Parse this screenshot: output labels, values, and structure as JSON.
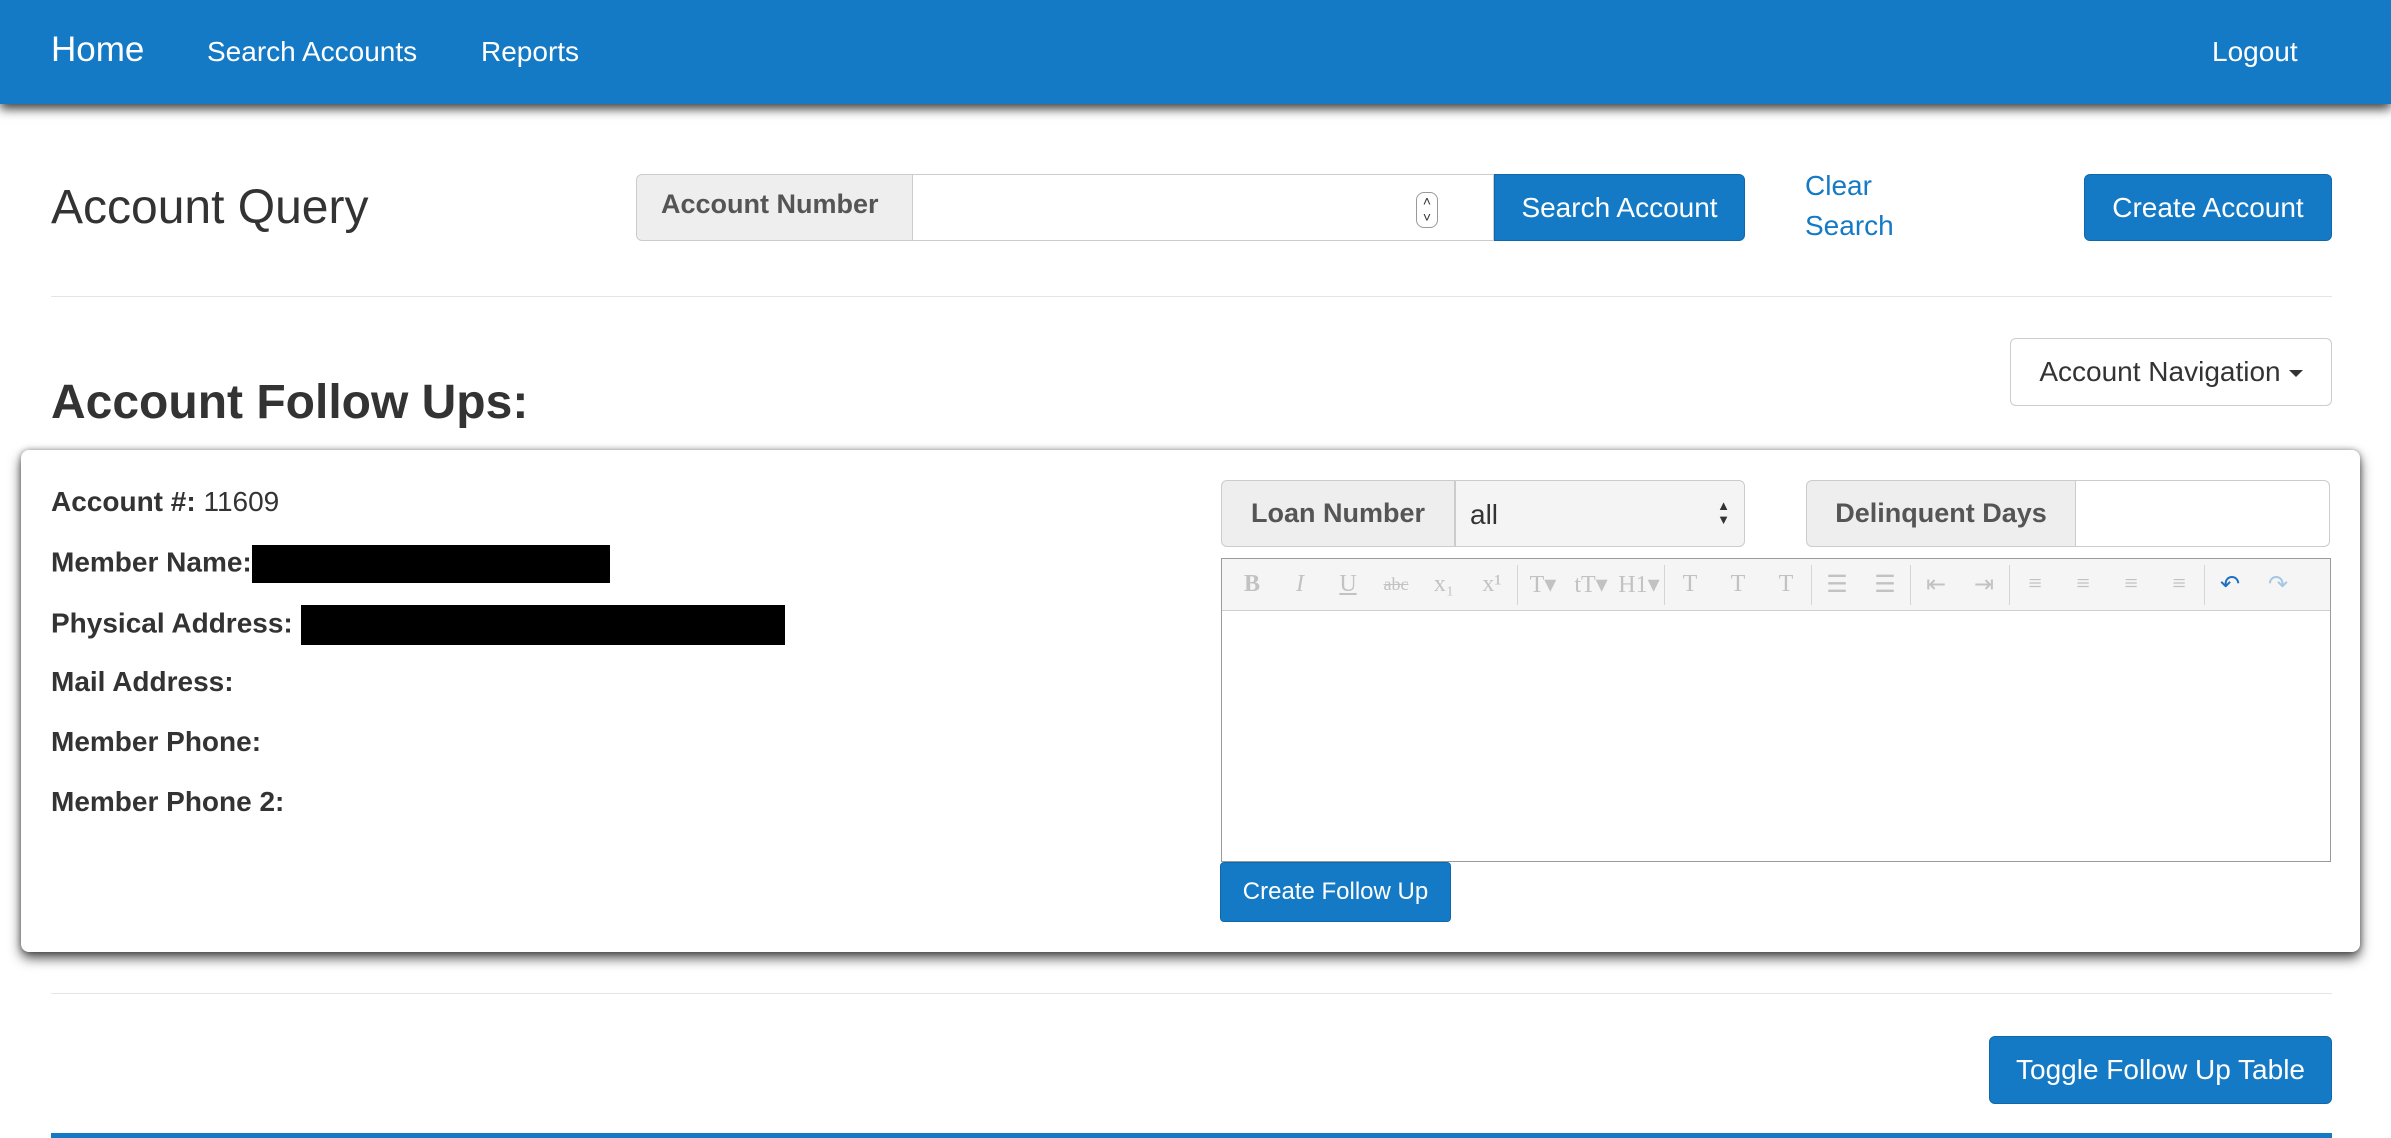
{
  "nav": {
    "brand": "Home",
    "items": [
      "Search Accounts",
      "Reports"
    ],
    "logout": "Logout"
  },
  "header": {
    "title": "Account Query",
    "account_number_label": "Account Number",
    "account_number_value": "",
    "search_button": "Search Account",
    "clear_search": "Clear Search",
    "create_account_button": "Create Account"
  },
  "followups": {
    "title": "Account Follow Ups:",
    "navigation_button": "Account Navigation"
  },
  "account": {
    "number_label": "Account #:",
    "number_value": "11609",
    "member_name_label": "Member Name:",
    "physical_address_label": "Physical Address:",
    "mail_address_label": "Mail Address:",
    "member_phone_label": "Member Phone:",
    "member_phone2_label": "Member Phone 2:"
  },
  "form": {
    "loan_number_label": "Loan Number",
    "loan_number_selected": "all",
    "delinquent_days_label": "Delinquent Days",
    "delinquent_days_value": "",
    "create_followup_button": "Create Follow Up"
  },
  "editor_toolbar": [
    {
      "icon": "bold-icon",
      "glyph": "B"
    },
    {
      "icon": "italic-icon",
      "glyph": "I"
    },
    {
      "icon": "underline-icon",
      "glyph": "U"
    },
    {
      "icon": "strikethrough-icon",
      "glyph": "abc"
    },
    {
      "icon": "subscript-icon",
      "glyph": "x₁"
    },
    {
      "icon": "superscript-icon",
      "glyph": "x¹"
    },
    {
      "icon": "font-size-icon",
      "glyph": "T▾"
    },
    {
      "icon": "line-height-icon",
      "glyph": "tT▾"
    },
    {
      "icon": "heading-icon",
      "glyph": "H1▾"
    },
    {
      "icon": "text-color-icon",
      "glyph": "T"
    },
    {
      "icon": "highlight-icon",
      "glyph": "T"
    },
    {
      "icon": "clear-format-icon",
      "glyph": "T"
    },
    {
      "icon": "bullet-list-icon",
      "glyph": "☰"
    },
    {
      "icon": "numbered-list-icon",
      "glyph": "☰"
    },
    {
      "icon": "outdent-icon",
      "glyph": "⇤"
    },
    {
      "icon": "indent-icon",
      "glyph": "⇥"
    },
    {
      "icon": "align-left-icon",
      "glyph": "≡"
    },
    {
      "icon": "align-center-icon",
      "glyph": "≡"
    },
    {
      "icon": "align-right-icon",
      "glyph": "≡"
    },
    {
      "icon": "align-justify-icon",
      "glyph": "≡"
    },
    {
      "icon": "undo-icon",
      "glyph": "↶"
    },
    {
      "icon": "redo-icon",
      "glyph": "↷"
    }
  ],
  "bottom": {
    "toggle_button": "Toggle Follow Up Table"
  },
  "colors": {
    "primary": "#157ac6",
    "text": "#333333",
    "addon_bg": "#eeeeee"
  }
}
